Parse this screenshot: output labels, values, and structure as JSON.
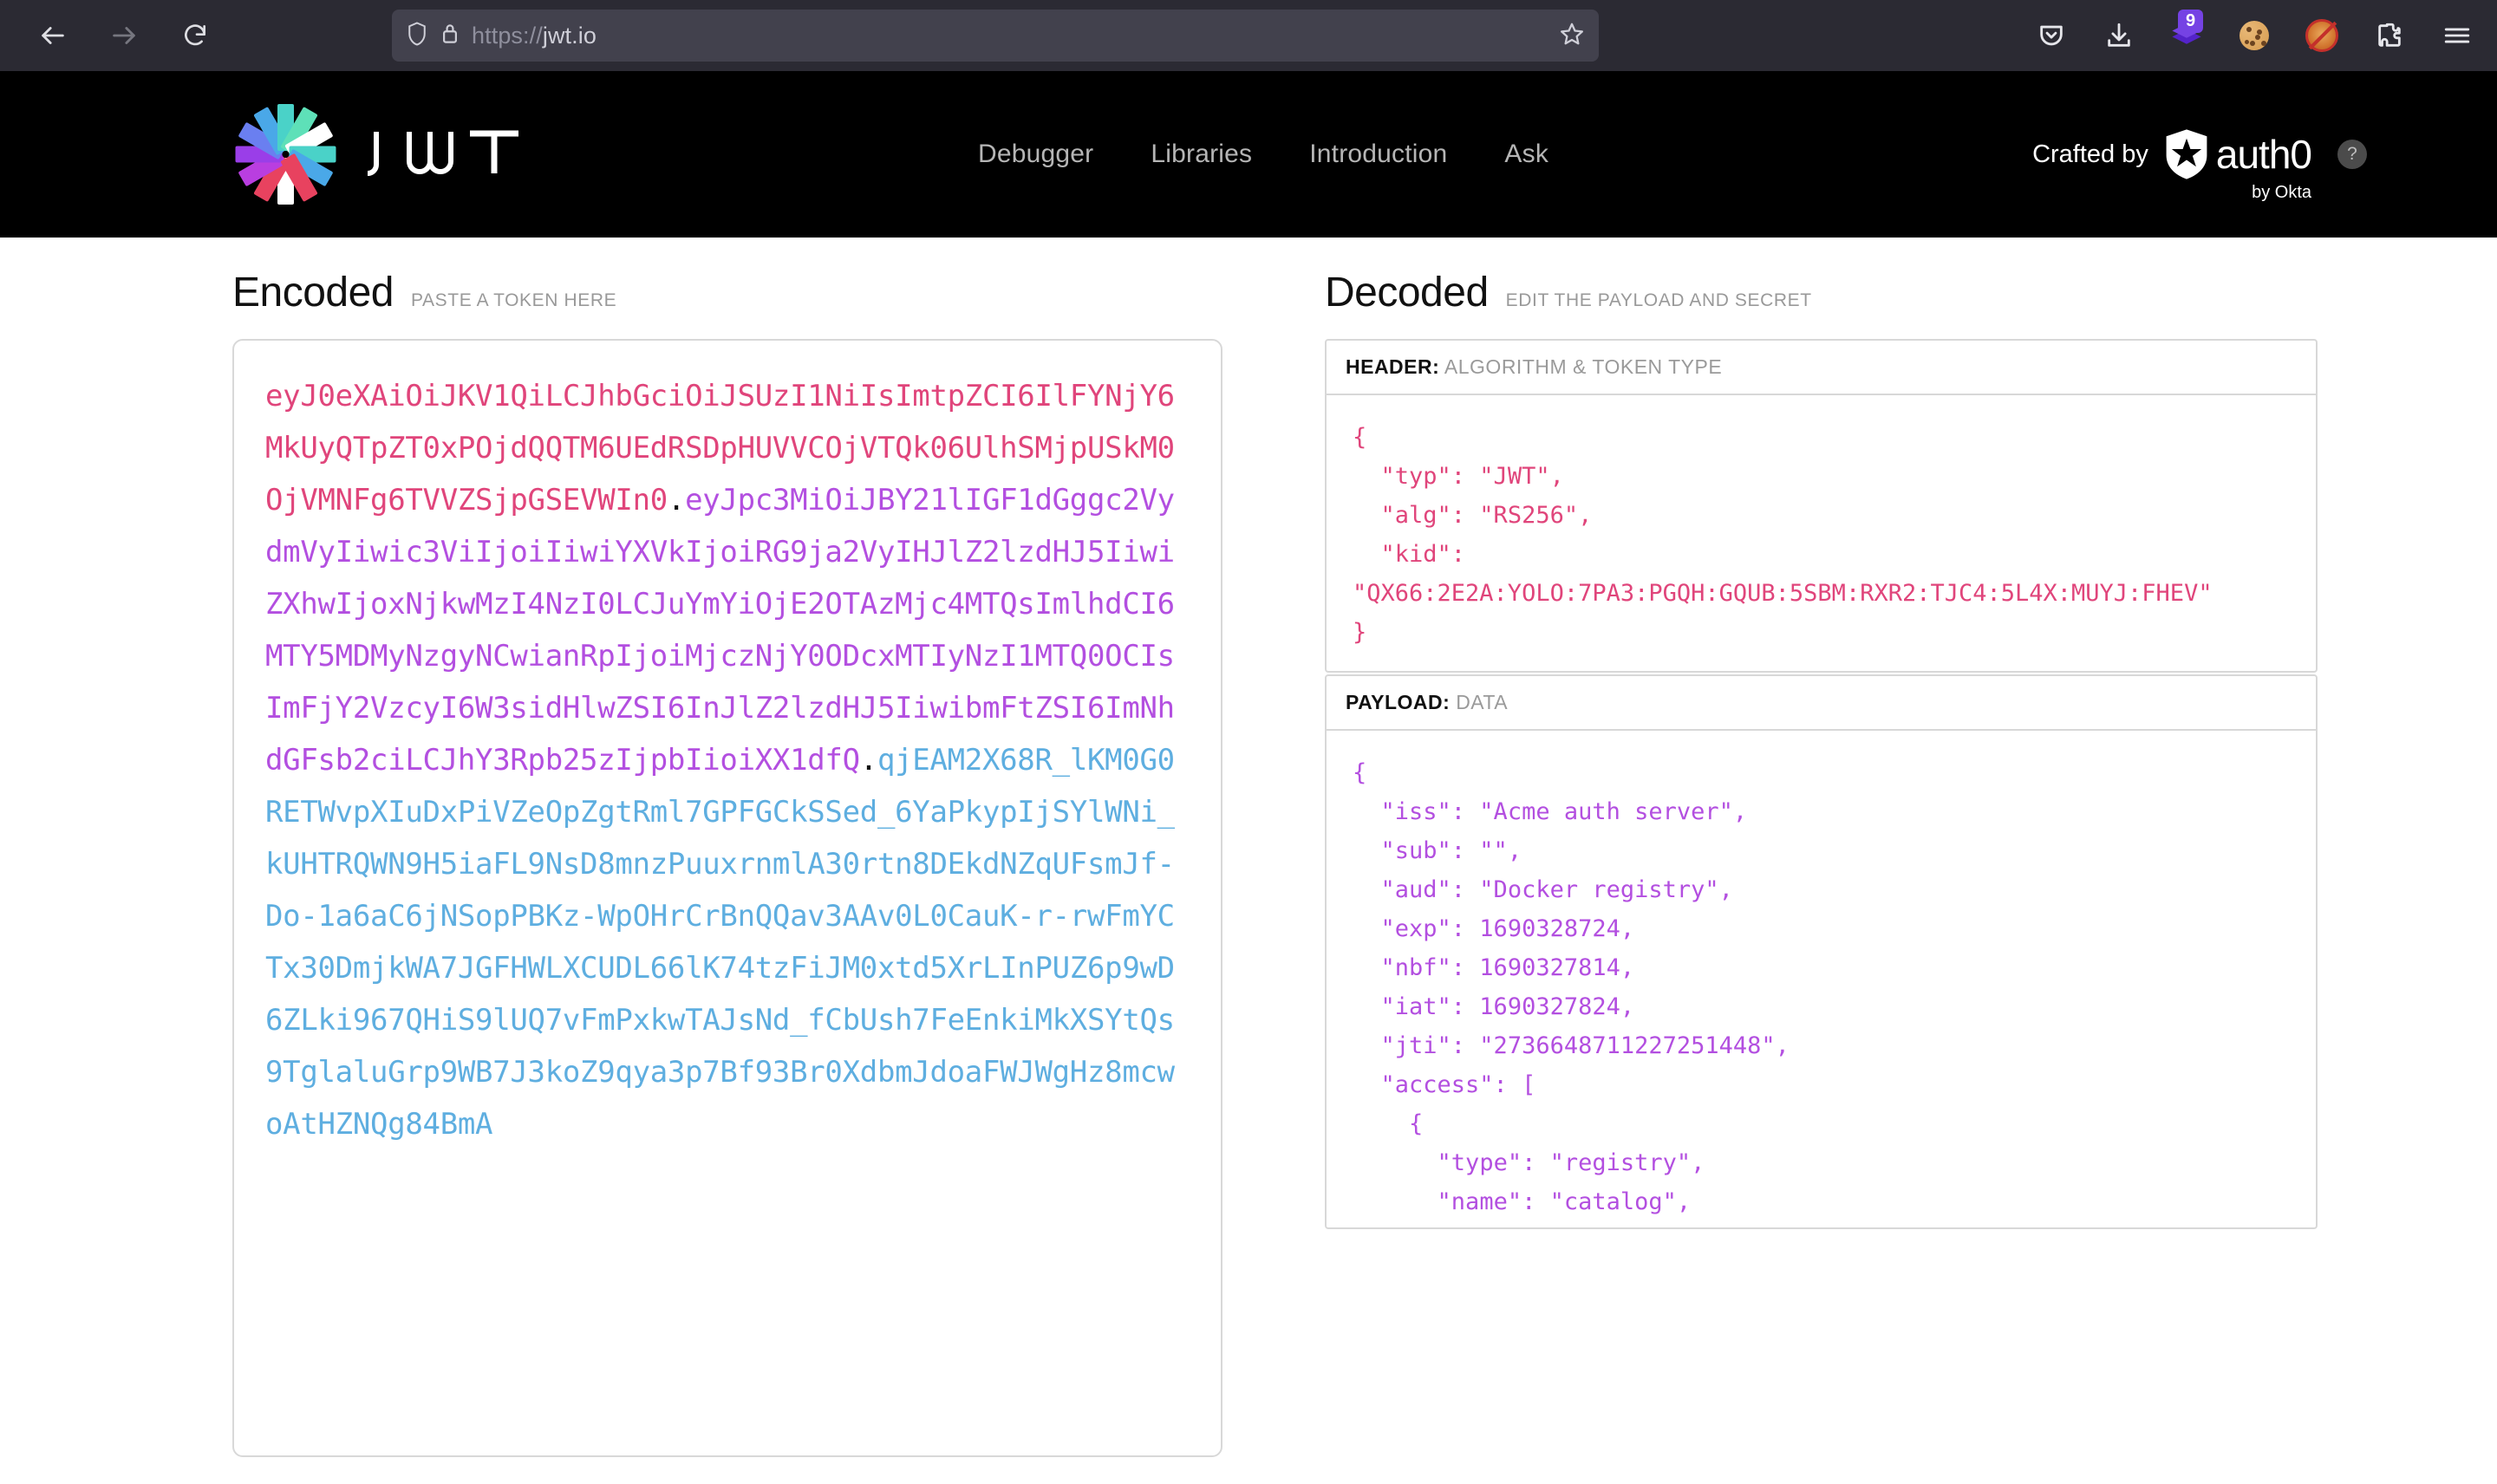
{
  "browser": {
    "url_scheme": "https://",
    "url_host": "jwt.io",
    "back_icon": "back-arrow-icon",
    "forward_icon": "forward-arrow-icon",
    "reload_icon": "reload-icon",
    "shield_icon": "shield-icon",
    "lock_icon": "padlock-icon",
    "bookmark_icon": "star-icon",
    "pocket_icon": "pocket-icon",
    "downloads_icon": "download-icon",
    "extension_badge_count": "9",
    "cookie_icon": "cookie-icon",
    "noscript_icon": "noscript-icon",
    "puzzle_icon": "extensions-puzzle-icon",
    "menu_icon": "hamburger-menu-icon"
  },
  "site_header": {
    "brand": "JWT",
    "logo_icon": "jwt-starburst-logo",
    "nav": [
      {
        "label": "Debugger"
      },
      {
        "label": "Libraries"
      },
      {
        "label": "Introduction"
      },
      {
        "label": "Ask"
      }
    ],
    "crafted_by_label": "Crafted by",
    "auth0_word": "auth0",
    "auth0_sub": "by Okta",
    "help_glyph": "?"
  },
  "encoded": {
    "title": "Encoded",
    "subtitle": "PASTE A TOKEN HERE",
    "token_header": "eyJ0eXAiOiJKV1QiLCJhbGciOiJSUzI1NiIsImtpZCI6IlFYNjY6MkUyQTpZT0xPOjdQQTM6UEdRSDpHUVVCOjVTQk06UlhSMjpUSkM0OjVMNFg6TVVZSjpGSEVWIn0",
    "token_payload": "eyJpc3MiOiJBY21lIGF1dGggc2VydmVyIiwic3ViIjoiIiwiYXVkIjoiRG9ja2VyIHJlZ2lzdHJ5IiwiZXhwIjoxNjkwMzI4NzI0LCJuYmYiOjE2OTAzMjc4MTQsImlhdCI6MTY5MDMyNzgyNCwianRpIjoiMjczNjY0ODcxMTIyNzI1MTQ0OCIsImFjY2VzcyI6W3sidHlwZSI6InJlZ2lzdHJ5IiwibmFtZSI6ImNhdGFsb2ciLCJhY3Rpb25zIjpbIioiXX1dfQ",
    "token_signature": "qjEAM2X68R_lKM0G0RETWvpXIuDxPiVZeOpZgtRml7GPFGCkSSed_6YaPkypIjSYlWNi_kUHTRQWN9H5iaFL9NsD8mnzPuuxrnmlA30rtn8DEkdNZqUFsmJf-Do-1a6aC6jNSopPBKz-WpOHrCrBnQQav3AAv0L0CauK-r-rwFmYCTx30DmjkWA7JGFHWLXCUDL66lK74tzFiJM0xtd5XrLInPUZ6p9wD6ZLki967QHiS9lUQ7vFmPxkwTAJsNd_fCbUsh7FeEnkiMkXSYtQs9TglaluGrp9WB7J3koZ9qya3p7Bf93Br0XdbmJdoaFWJWgHz8mcwoAtHZNQg84BmA",
    "dot": ".",
    "colors": {
      "header": "#e0457b",
      "payload": "#b34fe0",
      "signature": "#5eaee0"
    }
  },
  "decoded": {
    "title": "Decoded",
    "subtitle": "EDIT THE PAYLOAD AND SECRET",
    "header_block": {
      "label": "HEADER:",
      "sublabel": "ALGORITHM & TOKEN TYPE",
      "json": "{\n  \"typ\": \"JWT\",\n  \"alg\": \"RS256\",\n  \"kid\":\n\"QX66:2E2A:YOLO:7PA3:PGQH:GQUB:5SBM:RXR2:TJC4:5L4X:MUYJ:FHEV\"\n}"
    },
    "payload_block": {
      "label": "PAYLOAD:",
      "sublabel": "DATA",
      "json": "{\n  \"iss\": \"Acme auth server\",\n  \"sub\": \"\",\n  \"aud\": \"Docker registry\",\n  \"exp\": 1690328724,\n  \"nbf\": 1690327814,\n  \"iat\": 1690327824,\n  \"jti\": \"2736648711227251448\",\n  \"access\": [\n    {\n      \"type\": \"registry\",\n      \"name\": \"catalog\",\n      \"actions\": [\n        \"*\"\n      ]\n    }\n  ]\n}"
    }
  }
}
